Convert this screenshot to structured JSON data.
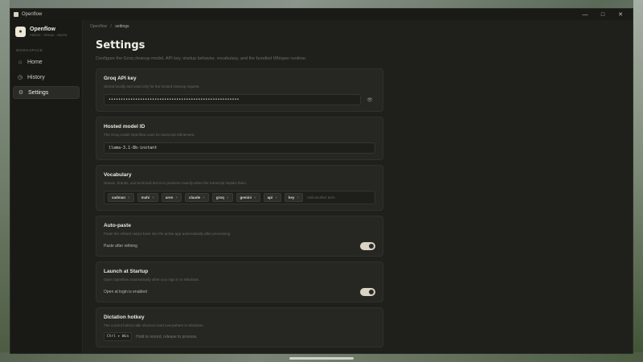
{
  "window": {
    "title": "Openflow",
    "controls": [
      "—",
      "□",
      "✕"
    ]
  },
  "sidebar": {
    "brand": {
      "name": "Openflow",
      "sub": "PRESS · SPEAK · PASTE"
    },
    "section_label": "WORKSPACE",
    "items": [
      {
        "label": "Home",
        "icon": "home-icon",
        "glyph": "⌂"
      },
      {
        "label": "History",
        "icon": "clock-icon",
        "glyph": "◷"
      },
      {
        "label": "Settings",
        "icon": "gear-icon",
        "glyph": "⚙"
      }
    ]
  },
  "breadcrumb": {
    "root": "Openflow",
    "separator": "/",
    "current": "settings"
  },
  "page": {
    "title": "Settings",
    "description": "Configure the Groq cleanup model, API key, startup behavior, vocabulary, and the bundled Whisper runtime."
  },
  "cards": {
    "api_key": {
      "title": "Groq API key",
      "desc": "Stored locally and used only for the hosted cleanup request.",
      "value": "••••••••••••••••••••••••••••••••••••••••••••••••••••••",
      "eye_glyph": "👁"
    },
    "model": {
      "title": "Hosted model ID",
      "desc": "The Groq model Openflow uses for transcript refinement.",
      "value": "llama-3.1-8b-instant"
    },
    "vocabulary": {
      "title": "Vocabulary",
      "desc": "Names, brands, and technical terms to preserve exactly when the transcript implies them.",
      "tags": [
        "sadman",
        "mahi",
        "aren",
        "claude",
        "groq",
        "gemini",
        "api",
        "key"
      ],
      "placeholder": "Add another term"
    },
    "autopaste": {
      "title": "Auto-paste",
      "desc": "Paste the refined output back into the active app automatically after processing.",
      "toggle_label": "Paste after refining",
      "enabled": true
    },
    "startup": {
      "title": "Launch at Startup",
      "desc": "Open Openflow automatically when you sign in to Windows.",
      "toggle_label": "Open at login is enabled",
      "enabled": true
    },
    "hotkey": {
      "title": "Dictation hotkey",
      "desc": "The current hold-to-talk shortcut used everywhere in Windows.",
      "keys": "Ctrl + Win",
      "hint": "Hold to record, release to process."
    }
  },
  "colors": {
    "accent": "#d9d4c4",
    "background": "#1f201c",
    "card": "#262722"
  }
}
